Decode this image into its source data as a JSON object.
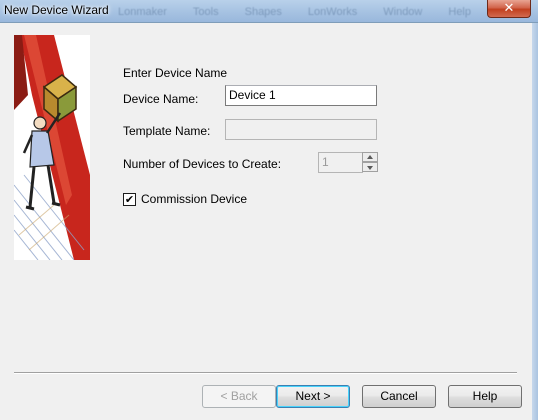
{
  "window": {
    "title": "New Device Wizard",
    "background_menu": [
      "Lonmaker",
      "Tools",
      "Shapes",
      "LonWorks",
      "Window",
      "Help"
    ]
  },
  "form": {
    "heading": "Enter Device Name",
    "device_name_label": "Device Name:",
    "device_name_value": "Device 1",
    "template_name_label": "Template Name:",
    "template_name_value": "",
    "num_devices_label": "Number of Devices to Create:",
    "num_devices_value": "1",
    "commission_label": "Commission Device",
    "commission_checked": true
  },
  "buttons": {
    "back": "< Back",
    "next": "Next >",
    "cancel": "Cancel",
    "help": "Help"
  },
  "icons": {
    "close": "close-icon",
    "illustration": "wizard-illustration-icon"
  }
}
